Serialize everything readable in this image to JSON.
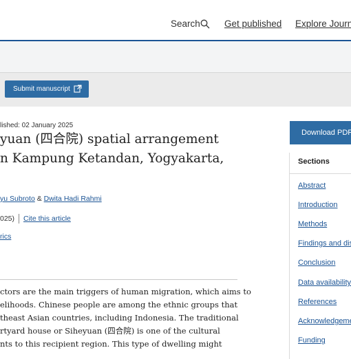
{
  "topnav": {
    "search_label": "Search",
    "published_label": "Get published",
    "explore_label": "Explore Journa"
  },
  "toolbar": {
    "submit_label": "Submit manuscript"
  },
  "article": {
    "published_date": "lished: 02 January 2025",
    "title_lines": [
      "yuan (四合院) spatial arrangement",
      "n Kampung Ketandan, Yogyakarta,"
    ],
    "authors": {
      "author1": "yu Subroto",
      "separator": " & ",
      "author2": "Dwita Hadi Rahmi"
    },
    "year": "025)",
    "cite_label": "Cite this article",
    "metrics_label": "rics",
    "abstract_lines": [
      "ctors are the main triggers of human migration, which aims to",
      "elihoods. Chinese people are among the ethnic groups that",
      "theast Asian countries, including Indonesia. The traditional",
      "rtyard house or Siheyuan (四合院) is one of the cultural",
      "nts to this recipient region. This type of dwelling might"
    ]
  },
  "sidebar": {
    "download_label": "Download PDF",
    "sections_heading": "Sections",
    "items": [
      "Abstract",
      "Introduction",
      "Methods",
      "Findings and dis",
      "Conclusion",
      "Data availability",
      "References",
      "Acknowledgeme",
      "Funding"
    ]
  }
}
